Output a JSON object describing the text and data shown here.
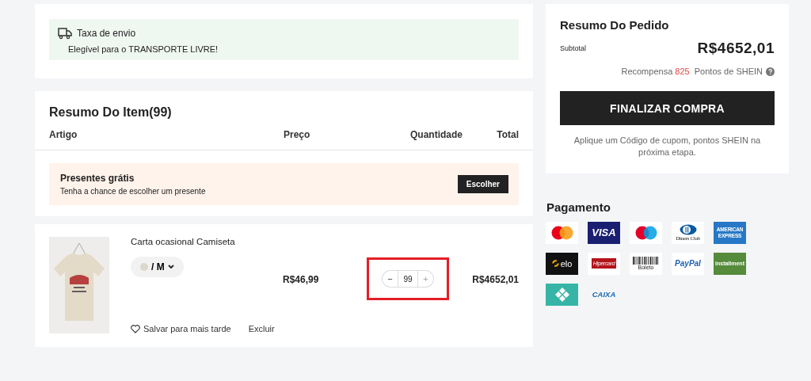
{
  "shipping": {
    "title": "Taxa de envio",
    "message": "Elegível para o TRANSPORTE LIVRE!"
  },
  "items_summary": {
    "title": "Resumo Do Item(99)",
    "columns": [
      "Artigo",
      "Preço",
      "Quantidade",
      "Total"
    ]
  },
  "gifts": {
    "title": "Presentes grátis",
    "subtitle": "Tenha a chance de escolher um presente",
    "button": "Escolher"
  },
  "cart_item": {
    "name": "Carta ocasional Camiseta",
    "variant": "/ M",
    "price": "R$46,99",
    "quantity": {
      "minus": "−",
      "value": "99",
      "plus": "+",
      "highlighted": true
    },
    "total": "R$4652,01",
    "save_link": "Salvar para mais tarde",
    "delete_link": "Excluir"
  },
  "order_summary": {
    "title": "Resumo Do Pedido",
    "subtotal_label": "Subtotal",
    "subtotal": "R$4652,01",
    "reward_prefix": "Recompensa",
    "reward_points": "825",
    "reward_suffix": "Pontos de SHEIN",
    "checkout_button": "FINALIZAR COMPRA",
    "note": "Aplique um Código de cupom, pontos SHEIN na próxima etapa."
  },
  "payment": {
    "title": "Pagamento",
    "methods": [
      {
        "kind": "mastercard"
      },
      {
        "kind": "visa",
        "label": "VISA"
      },
      {
        "kind": "maestro"
      },
      {
        "kind": "diners",
        "label": "Diners Club"
      },
      {
        "kind": "amex",
        "label": "AMERICAN EXPRESS"
      },
      {
        "kind": "elo",
        "label": "elo"
      },
      {
        "kind": "hipercard",
        "label": "Hipercard"
      },
      {
        "kind": "boleto",
        "label": "Boleto"
      },
      {
        "kind": "paypal",
        "label": "PayPal"
      },
      {
        "kind": "installment",
        "label": "installment"
      },
      {
        "kind": "pix"
      },
      {
        "kind": "caixa",
        "label": "CAIXA"
      }
    ]
  }
}
